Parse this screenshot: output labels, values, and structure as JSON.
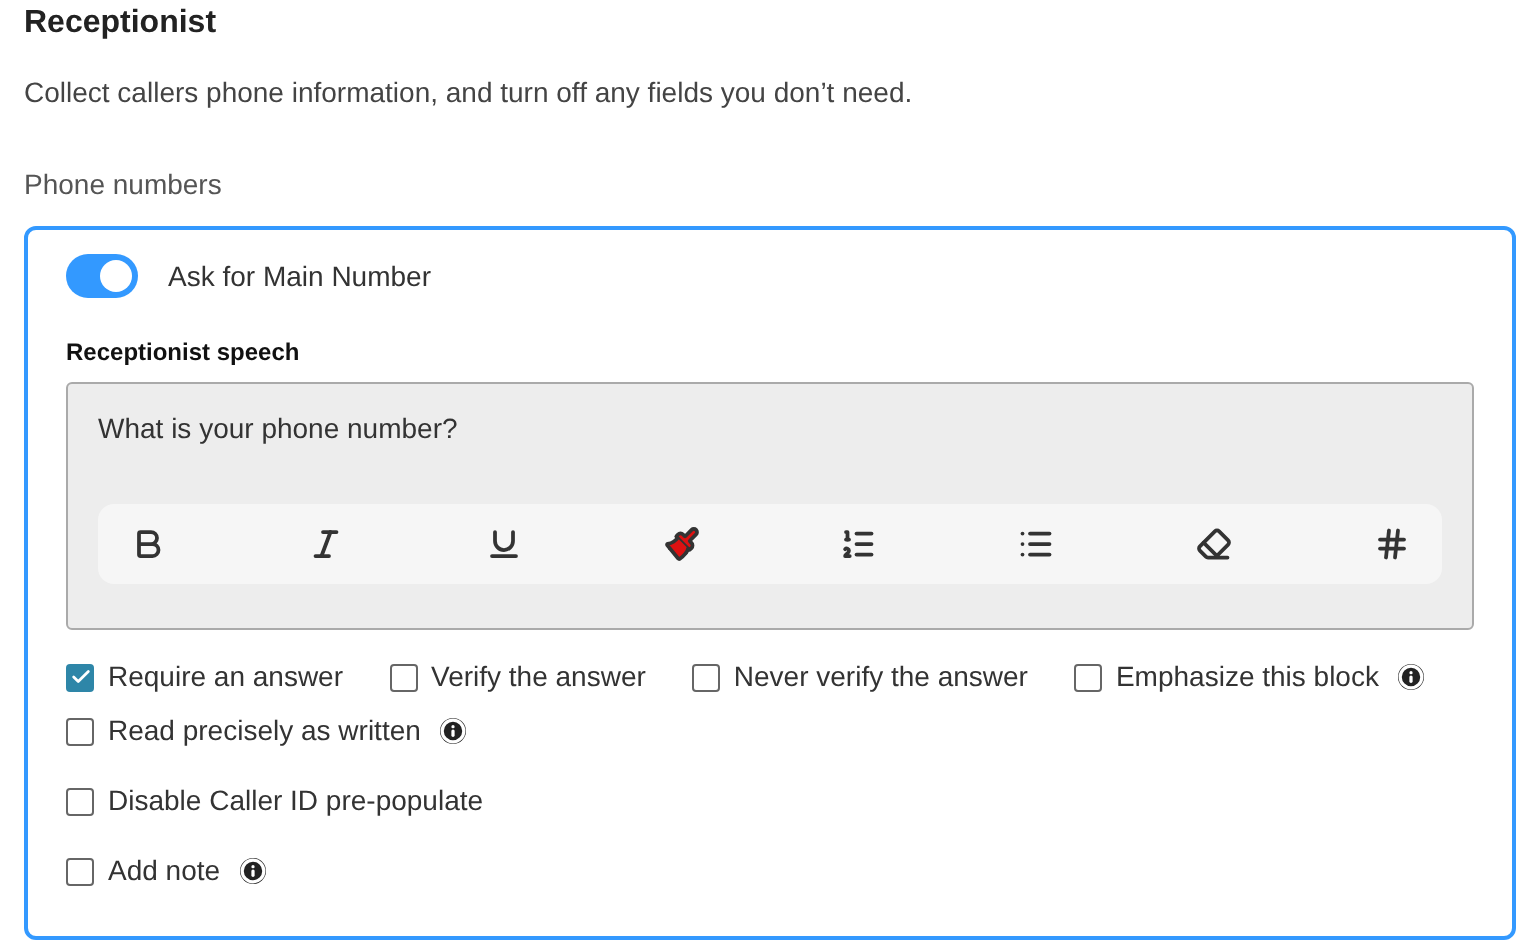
{
  "title": "Receptionist",
  "description": "Collect callers phone information, and turn off any fields you don’t need.",
  "section_label": "Phone numbers",
  "card": {
    "toggle": {
      "label": "Ask for Main Number",
      "on": true
    },
    "speech": {
      "label": "Receptionist speech",
      "value": "What is your phone number?"
    },
    "option_rows": [
      [
        {
          "label": "Require an answer",
          "checked": true,
          "info": false
        },
        {
          "label": "Verify the answer",
          "checked": false,
          "info": false
        },
        {
          "label": "Never verify the answer",
          "checked": false,
          "info": false
        },
        {
          "label": "Emphasize this block",
          "checked": false,
          "info": true
        }
      ],
      [
        {
          "label": "Read precisely as written",
          "checked": false,
          "info": true
        }
      ],
      [
        {
          "label": "Disable Caller ID pre-populate",
          "checked": false,
          "info": false
        }
      ],
      [
        {
          "label": "Add note",
          "checked": false,
          "info": true
        }
      ]
    ]
  }
}
